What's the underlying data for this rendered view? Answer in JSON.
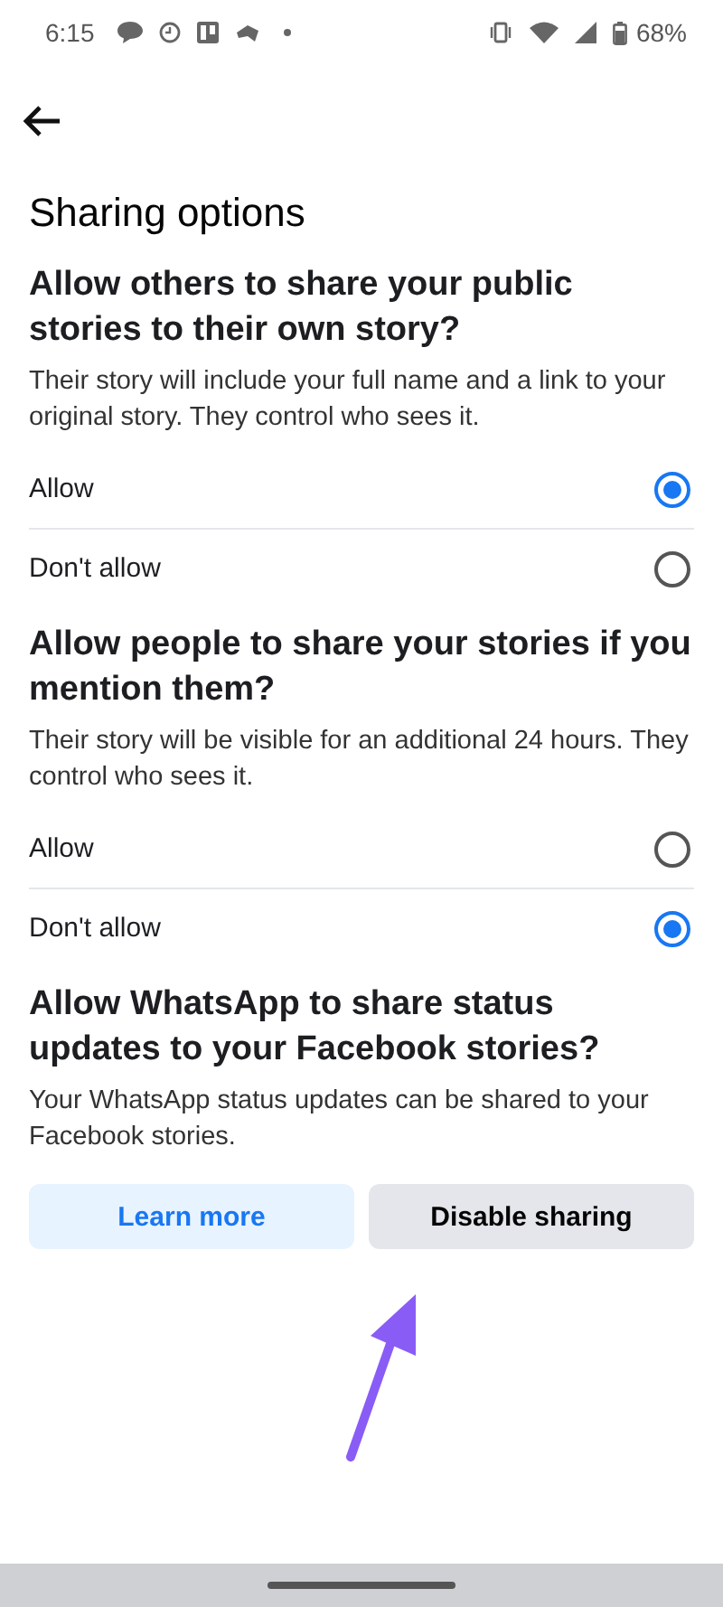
{
  "status_bar": {
    "time": "6:15",
    "battery": "68%"
  },
  "title": "Sharing options",
  "sections": [
    {
      "kind": "radio",
      "heading": "Allow others to share your public stories to their own story?",
      "description": "Their story will include your full name and a link to your original story. They control who sees it.",
      "options": [
        {
          "label": "Allow",
          "selected": true
        },
        {
          "label": "Don't allow",
          "selected": false
        }
      ]
    },
    {
      "kind": "radio",
      "heading": "Allow people to share your stories if you mention them?",
      "description": "Their story will be visible for an additional 24 hours. They control who sees it.",
      "options": [
        {
          "label": "Allow",
          "selected": false
        },
        {
          "label": "Don't allow",
          "selected": true
        }
      ]
    },
    {
      "kind": "buttons",
      "heading": "Allow WhatsApp to share status updates to your Facebook stories?",
      "description": "Your WhatsApp status updates can be shared to your Facebook stories.",
      "buttons": [
        {
          "label": "Learn more",
          "kind": "secondary"
        },
        {
          "label": "Disable sharing",
          "kind": "neutral"
        }
      ]
    }
  ]
}
